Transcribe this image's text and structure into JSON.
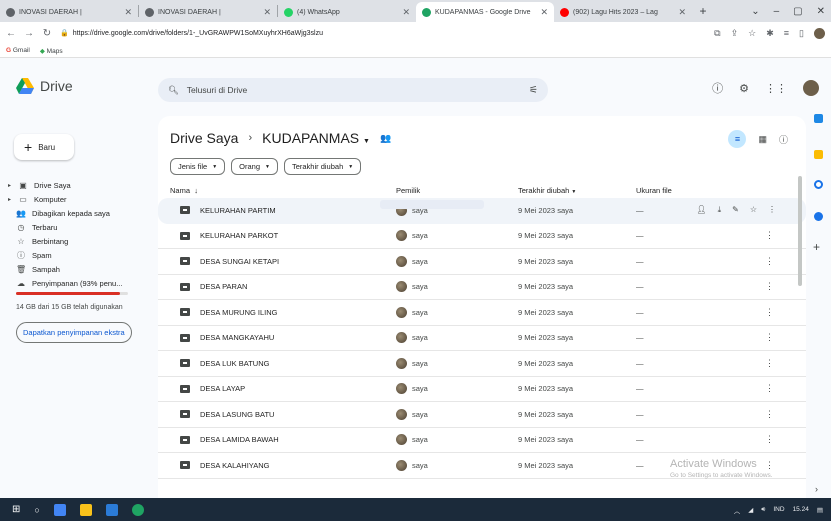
{
  "browser": {
    "tabs": [
      {
        "title": "INOVASI DAERAH |",
        "color": "#5f6368",
        "active": false
      },
      {
        "title": "INOVASI DAERAH |",
        "color": "#5f6368",
        "active": false
      },
      {
        "title": "(4) WhatsApp",
        "color": "#25d366",
        "active": false
      },
      {
        "title": "KUDAPANMAS - Google Drive",
        "color": "#1fa463",
        "active": true
      },
      {
        "title": "(902) Lagu Hits 2023 – Lag",
        "color": "#ff0000",
        "active": false
      }
    ],
    "url": "https://drive.google.com/drive/folders/1-_UvGRAWPW1SoMXuyhrXH6aWjg3slzu",
    "bookmarks": [
      "Gmail",
      "Maps"
    ]
  },
  "drive": {
    "app_name": "Drive",
    "search_placeholder": "Telusuri di Drive",
    "sidebar": {
      "new_label": "Baru",
      "items": [
        {
          "label": "Drive Saya",
          "icon": "my-drive-icon",
          "glyph": "▣",
          "caret": true
        },
        {
          "label": "Komputer",
          "icon": "computer-icon",
          "glyph": "▭",
          "caret": true
        },
        {
          "label": "Dibagikan kepada saya",
          "icon": "shared-icon",
          "glyph": "👥",
          "caret": false
        },
        {
          "label": "Terbaru",
          "icon": "recent-icon",
          "glyph": "◷",
          "caret": false
        },
        {
          "label": "Berbintang",
          "icon": "star-icon",
          "glyph": "☆",
          "caret": false
        },
        {
          "label": "Spam",
          "icon": "spam-icon",
          "glyph": "ⓘ",
          "caret": false
        },
        {
          "label": "Sampah",
          "icon": "trash-icon",
          "glyph": "🗑",
          "caret": false
        },
        {
          "label": "Penyimpanan (93% penu...",
          "icon": "cloud-icon",
          "glyph": "☁",
          "caret": false
        }
      ],
      "storage_fraction": 0.93,
      "storage_text": "14 GB dari 15 GB telah digunakan",
      "get_storage_label": "Dapatkan penyimpanan ekstra"
    },
    "breadcrumb": {
      "root": "Drive Saya",
      "current": "KUDAPANMAS"
    },
    "filters": [
      "Jenis file",
      "Orang",
      "Terakhir diubah"
    ],
    "columns": {
      "name": "Nama",
      "owner": "Pemilik",
      "modified": "Terakhir diubah",
      "size": "Ukuran file"
    },
    "rows": [
      {
        "name": "KELURAHAN PARTIM",
        "owner": "saya",
        "modified": "9 Mei 2023 saya",
        "size": "—"
      },
      {
        "name": "KELURAHAN PARKOT",
        "owner": "saya",
        "modified": "9 Mei 2023 saya",
        "size": "—"
      },
      {
        "name": "DESA SUNGAI KETAPI",
        "owner": "saya",
        "modified": "9 Mei 2023 saya",
        "size": "—"
      },
      {
        "name": "DESA PARAN",
        "owner": "saya",
        "modified": "9 Mei 2023 saya",
        "size": "—"
      },
      {
        "name": "DESA MURUNG ILING",
        "owner": "saya",
        "modified": "9 Mei 2023 saya",
        "size": "—"
      },
      {
        "name": "DESA MANGKAYAHU",
        "owner": "saya",
        "modified": "9 Mei 2023 saya",
        "size": "—"
      },
      {
        "name": "DESA LUK BATUNG",
        "owner": "saya",
        "modified": "9 Mei 2023 saya",
        "size": "—"
      },
      {
        "name": "DESA LAYAP",
        "owner": "saya",
        "modified": "9 Mei 2023 saya",
        "size": "—"
      },
      {
        "name": "DESA LASUNG BATU",
        "owner": "saya",
        "modified": "9 Mei 2023 saya",
        "size": "—"
      },
      {
        "name": "DESA LAMIDA BAWAH",
        "owner": "saya",
        "modified": "9 Mei 2023 saya",
        "size": "—"
      },
      {
        "name": "DESA KALAHIYANG",
        "owner": "saya",
        "modified": "9 Mei 2023 saya",
        "size": "—"
      }
    ],
    "watermark": {
      "title": "Activate Windows",
      "subtitle": "Go to Settings to activate Windows."
    }
  },
  "taskbar": {
    "lang": "IND",
    "time": "15.24"
  }
}
